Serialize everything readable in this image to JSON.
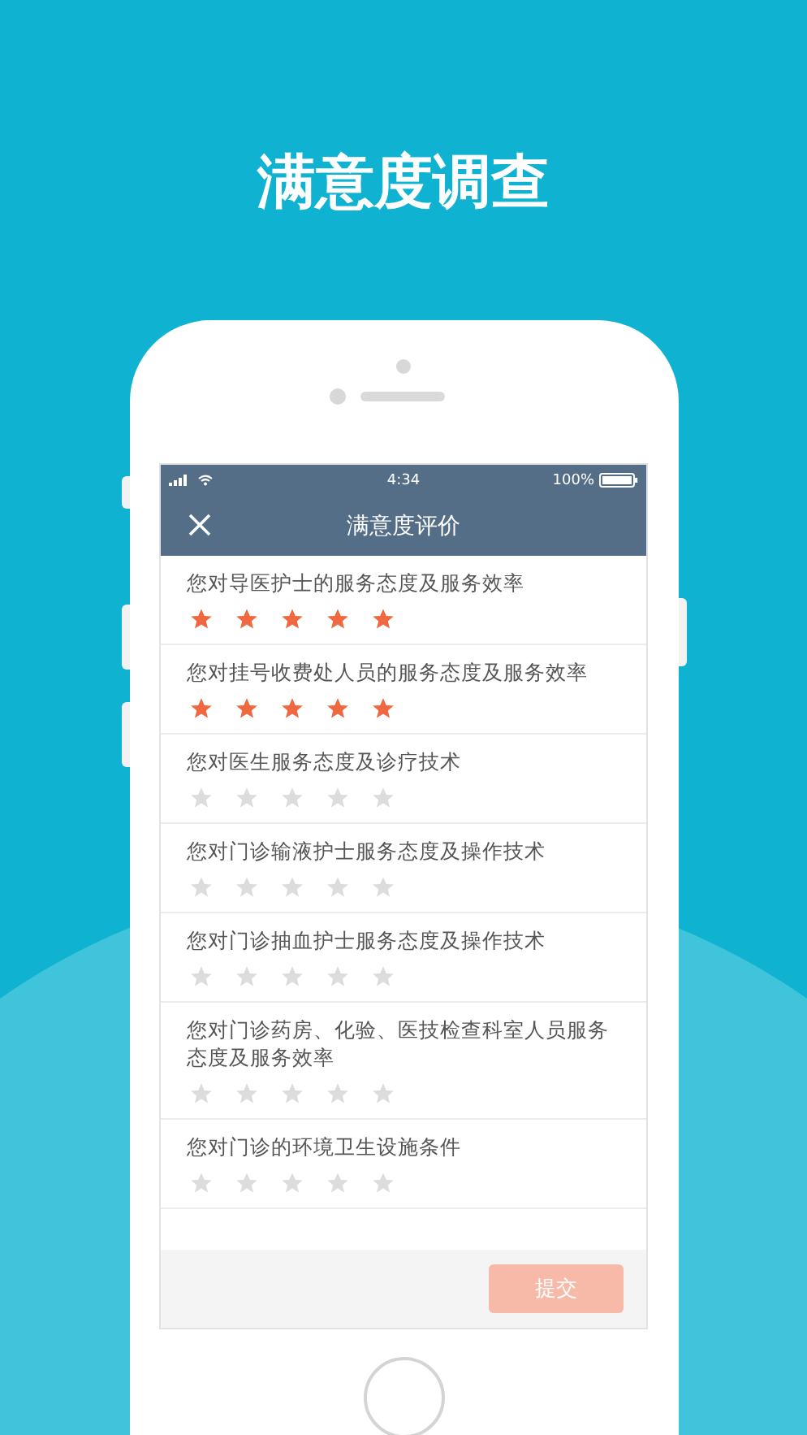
{
  "headline": "满意度调查",
  "status_bar": {
    "time": "4:34",
    "battery": "100%"
  },
  "nav": {
    "title": "满意度评价"
  },
  "questions": [
    {
      "text": "您对导医护士的服务态度及服务效率",
      "stars": 5
    },
    {
      "text": "您对挂号收费处人员的服务态度及服务效率",
      "stars": 5
    },
    {
      "text": "您对医生服务态度及诊疗技术",
      "stars": 0
    },
    {
      "text": "您对门诊输液护士服务态度及操作技术",
      "stars": 0
    },
    {
      "text": "您对门诊抽血护士服务态度及操作技术",
      "stars": 0
    },
    {
      "text": "您对门诊药房、化验、医技检查科室人员服务态度及服务效率",
      "stars": 0
    },
    {
      "text": "您对门诊的环境卫生设施条件",
      "stars": 0
    }
  ],
  "submit": {
    "label": "提交",
    "disabled": true
  }
}
